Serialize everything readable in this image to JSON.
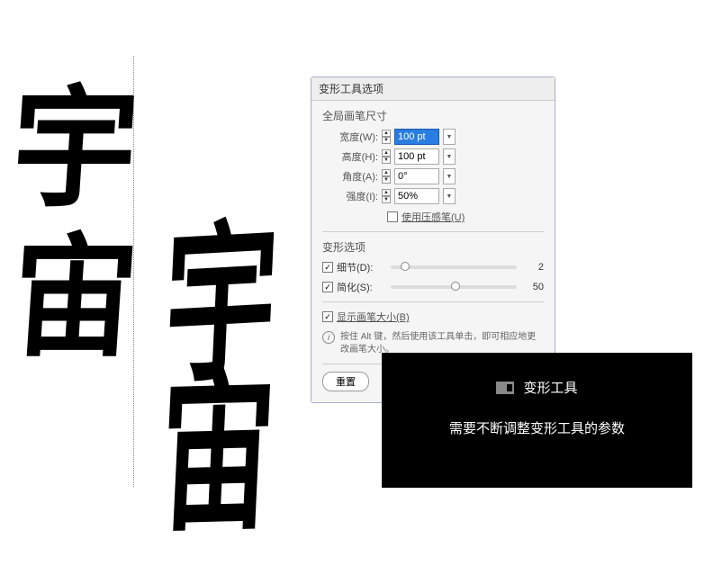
{
  "chars": {
    "left1": "宇",
    "left2": "宙",
    "right1": "宇",
    "right2": "宙"
  },
  "dialog": {
    "title": "变形工具选项",
    "brush_section": "全局画笔尺寸",
    "width_label": "宽度(W):",
    "width_value": "100 pt",
    "height_label": "高度(H):",
    "height_value": "100 pt",
    "angle_label": "角度(A):",
    "angle_value": "0°",
    "intensity_label": "强度(I):",
    "intensity_value": "50%",
    "pressure_label": "使用压感笔(U)",
    "options_section": "变形选项",
    "detail_label": "细节(D):",
    "detail_value": "2",
    "simplify_label": "简化(S):",
    "simplify_value": "50",
    "show_size_label": "显示画笔大小(B)",
    "info_text": "按住 Alt 键，然后使用该工具单击，即可相应地更改画笔大小。",
    "reset_label": "重置"
  },
  "tooltip": {
    "title": "变形工具",
    "desc": "需要不断调整变形工具的参数"
  }
}
